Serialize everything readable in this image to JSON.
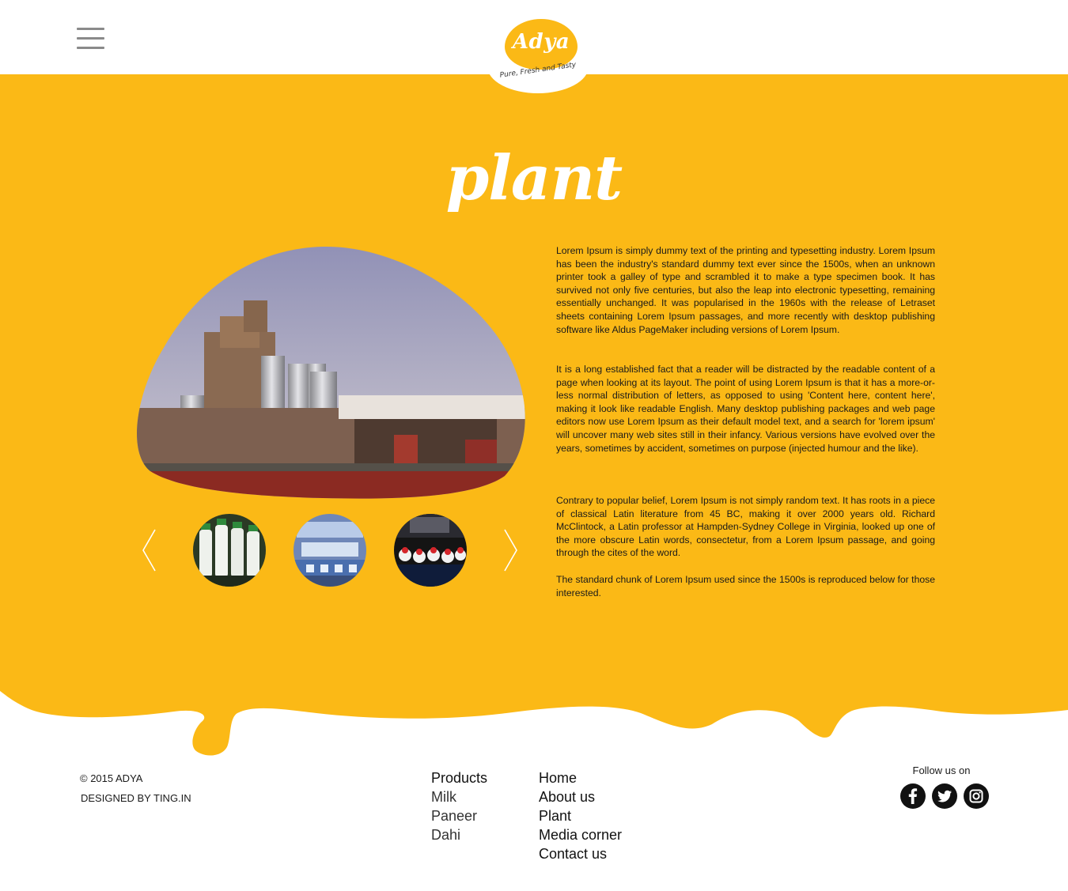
{
  "header": {
    "menu_icon": "hamburger-icon",
    "logo": {
      "name": "Adya",
      "tagline": "Pure, Fresh and Tasty"
    }
  },
  "page": {
    "title": "plant"
  },
  "gallery": {
    "prev_icon": "chevron-left-icon",
    "next_icon": "chevron-right-icon",
    "thumbnails": [
      "milk-bottles-thumbnail",
      "packaging-line-thumbnail",
      "bottling-conveyor-thumbnail"
    ]
  },
  "content": {
    "paragraphs": [
      "Lorem Ipsum is simply dummy text of the printing and typesetting industry. Lorem Ipsum has been the industry's standard dummy text ever since the 1500s, when an unknown printer took a galley of type and scrambled it to make a type specimen book. It has survived not only five centuries, but also the leap into electronic typesetting, remaining essentially unchanged. It was popularised in the 1960s with the release of Letraset sheets containing Lorem Ipsum passages, and more recently with desktop publishing software like Aldus PageMaker including versions of Lorem Ipsum.",
      "It is a long established fact that a reader will be distracted by the readable content of a page when looking at its layout. The point of using Lorem Ipsum is that it has a more-or-less normal distribution of letters, as opposed to using 'Content here, content here', making it look like readable English. Many desktop publishing packages and web page editors now use Lorem Ipsum as their default model text, and a search for 'lorem ipsum' will uncover many web sites still in their infancy. Various versions have evolved over the years, sometimes by accident, sometimes on purpose (injected humour and the like).",
      "Contrary to popular belief, Lorem Ipsum is not simply random text. It has roots in a piece of classical Latin literature from 45 BC, making it over 2000 years old. Richard McClintock, a Latin professor at Hampden-Sydney College in Virginia, looked up one of the more obscure Latin words, consectetur, from a Lorem Ipsum passage, and going through the cites of the word.",
      "The standard chunk of Lorem Ipsum used since the 1500s is reproduced below for those interested."
    ]
  },
  "footer": {
    "copyright": "© 2015 ADYA",
    "designed_by": "DESIGNED BY TING.IN",
    "products": {
      "heading": "Products",
      "items": [
        "Milk",
        "Paneer",
        "Dahi"
      ]
    },
    "nav": [
      "Home",
      "About us",
      "Plant",
      "Media corner",
      "Contact us"
    ],
    "follow_label": "Follow us on",
    "social_icons": [
      "facebook-icon",
      "twitter-icon",
      "instagram-icon"
    ]
  },
  "colors": {
    "brand_yellow": "#fbb916",
    "text_dark": "#1a1a1a",
    "white": "#ffffff"
  }
}
